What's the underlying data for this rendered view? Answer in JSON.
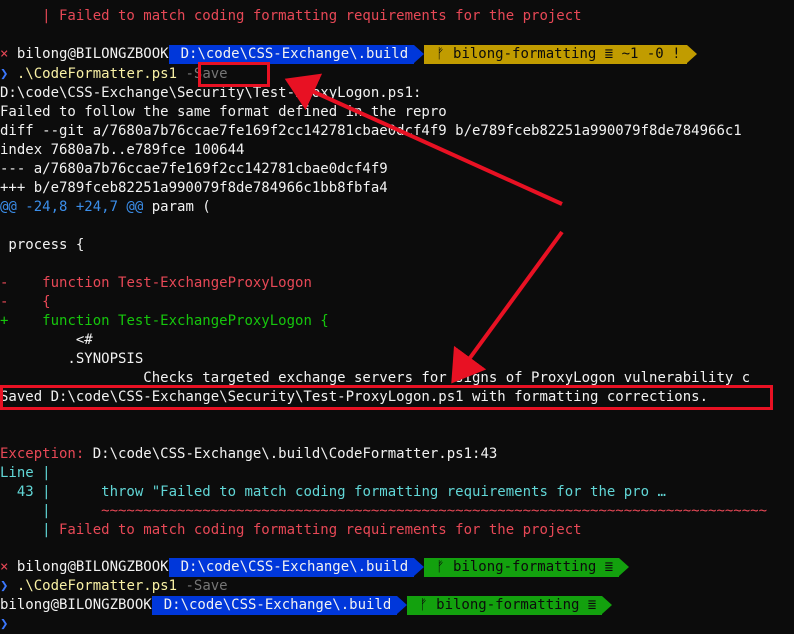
{
  "lines": {
    "l0": "     | Failed to match coding formatting requirements for the project",
    "prompt1": {
      "x": "×",
      "user": "bilong@BILONGZBOOK",
      "path": "D:\\code\\CSS-Exchange\\.build",
      "branch_icon": "ᚠ",
      "branch": "bilong-formatting ≣ ~1 -0 !"
    },
    "cmd1": {
      "chevron": "❯",
      "script": ".\\CodeFormatter.ps1",
      "arg": "-Save"
    },
    "file_header": "D:\\code\\CSS-Exchange\\Security\\Test-ProxyLogon.ps1:",
    "failed_follow": "Failed to follow the same format defined in the repro",
    "diff_git": "diff --git a/7680a7b76ccae7fe169f2cc142781cbae0dcf4f9 b/e789fceb82251a990079f8de784966c1",
    "index": "index 7680a7b..e789fce 100644",
    "minus_file": "--- a/7680a7b76ccae7fe169f2cc142781cbae0dcf4f9",
    "plus_file": "+++ b/e789fceb82251a990079f8de784966c1bb8fbfa4",
    "hunk": "@@ -24,8 +24,7 @@",
    "hunk_ctx": " param (",
    "process": " process {",
    "minus1_sign": "-",
    "minus1": "    function Test-ExchangeProxyLogon",
    "minus2_sign": "-",
    "minus2": "    {",
    "plus1_sign": "+",
    "plus1": "    function Test-ExchangeProxyLogon {",
    "ctx1": "         <#",
    "ctx2": "        .SYNOPSIS",
    "ctx3": "                 Checks targeted exchange servers for signs of ProxyLogon vulnerability c",
    "saved": "Saved D:\\code\\CSS-Exchange\\Security\\Test-ProxyLogon.ps1 with formatting corrections.",
    "exception_label": "Exception:",
    "exception_path": " D:\\code\\CSS-Exchange\\.build\\CodeFormatter.ps1:43",
    "line_label": "Line |",
    "line_num": "  43 |",
    "throw": "      throw \"Failed to match coding formatting requirements for the pro …",
    "pipe1": "     |",
    "squiggle": "      ~~~~~~~~~~~~~~~~~~~~~~~~~~~~~~~~~~~~~~~~~~~~~~~~~~~~~~~~~~~~~~~~~~~~~~~~~~~~~~~",
    "pipe2": "     |",
    "failed2": " Failed to match coding formatting requirements for the project",
    "prompt2": {
      "x": "×",
      "user": "bilong@BILONGZBOOK",
      "path": "D:\\code\\CSS-Exchange\\.build",
      "branch_icon": "ᚠ",
      "branch": "bilong-formatting ≣"
    },
    "cmd2": {
      "chevron": "❯",
      "script": ".\\CodeFormatter.ps1",
      "arg": "-Save"
    },
    "prompt3": {
      "user": "bilong@BILONGZBOOK",
      "path": "D:\\code\\CSS-Exchange\\.build",
      "branch_icon": "ᚠ",
      "branch": "bilong-formatting ≣"
    },
    "cmd3": {
      "chevron": "❯"
    }
  },
  "colors": {
    "background": "#0c0c0c",
    "error_red": "#e74856",
    "path_blue": "#0037da",
    "branch_yellow": "#c19c00",
    "branch_green": "#13a10e",
    "annotation_red": "#e81123"
  }
}
